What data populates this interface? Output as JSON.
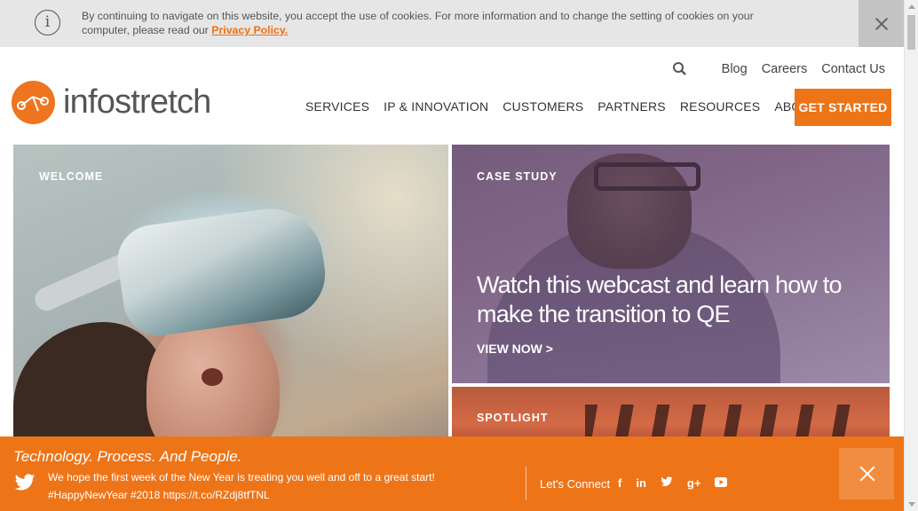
{
  "cookie_bar": {
    "text": "By continuing to navigate on this website, you accept the use of cookies. For more information and to change the setting of cookies on your computer, please read our ",
    "link_label": "Privacy Policy."
  },
  "header": {
    "logo_text": "infostretch",
    "top_links": [
      "Blog",
      "Careers",
      "Contact Us"
    ],
    "main_nav": [
      "SERVICES",
      "IP & INNOVATION",
      "CUSTOMERS",
      "PARTNERS",
      "RESOURCES",
      "ABOUT"
    ],
    "cta_label": "GET STARTED"
  },
  "tiles": {
    "welcome": {
      "label": "WELCOME"
    },
    "case_study": {
      "label": "CASE STUDY",
      "headline": "Watch this webcast and learn how to make the transition to QE",
      "link": "VIEW NOW >"
    },
    "spotlight": {
      "label": "SPOTLIGHT"
    }
  },
  "footer_bar": {
    "tagline": "Technology. Process. And People.",
    "tweet_line1": "We hope the first week of the New Year is treating you well and off to a great start!",
    "tweet_line2": "#HappyNewYear #2018 https://t.co/RZdj8tfTNL",
    "connect_label": "Let's Connect",
    "social_icons": [
      "facebook-icon",
      "linkedin-icon",
      "twitter-icon",
      "google-plus-icon",
      "youtube-icon"
    ]
  },
  "colors": {
    "brand_orange": "#ee7418",
    "link_orange": "#ec7014"
  }
}
